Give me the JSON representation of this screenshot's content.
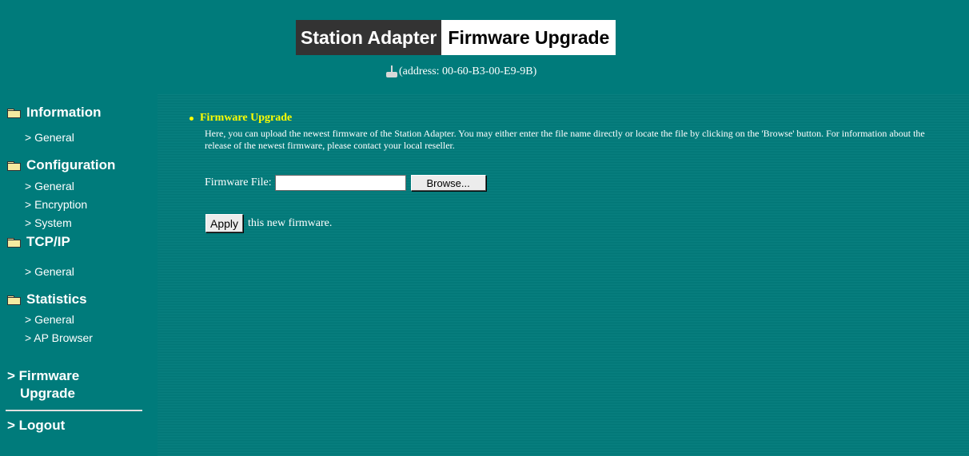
{
  "header": {
    "title_part1": "Station Adapter",
    "title_part2": "Firmware Upgrade",
    "address_text": "(address: 00-60-B3-00-E9-9B)"
  },
  "sidebar": {
    "sections": [
      {
        "label": "Information",
        "items": [
          "> General"
        ]
      },
      {
        "label": "Configuration",
        "items": [
          "> General",
          "> Encryption",
          "> System"
        ]
      },
      {
        "label": "TCP/IP",
        "items": [
          "> General"
        ]
      },
      {
        "label": "Statistics",
        "items": [
          "> General",
          "> AP Browser"
        ]
      }
    ],
    "firmware_link_line1": "> Firmware",
    "firmware_link_line2": "Upgrade",
    "logout_link": "> Logout"
  },
  "content": {
    "heading": "Firmware Upgrade",
    "description": "Here, you can upload the newest firmware of the Station Adapter. You may either enter the file name directly or locate the file by clicking on the 'Browse' button. For information about the release of the newest firmware, please contact your local reseller.",
    "file_label": "Firmware File:",
    "file_value": "",
    "browse_label": "Browse...",
    "apply_label": "Apply",
    "apply_suffix": "this new firmware."
  },
  "colors": {
    "background": "#007b7b",
    "heading": "#ffff00",
    "title_dark": "#333333"
  },
  "icons": [
    "antenna-icon",
    "folder-icon",
    "bullet-icon"
  ]
}
